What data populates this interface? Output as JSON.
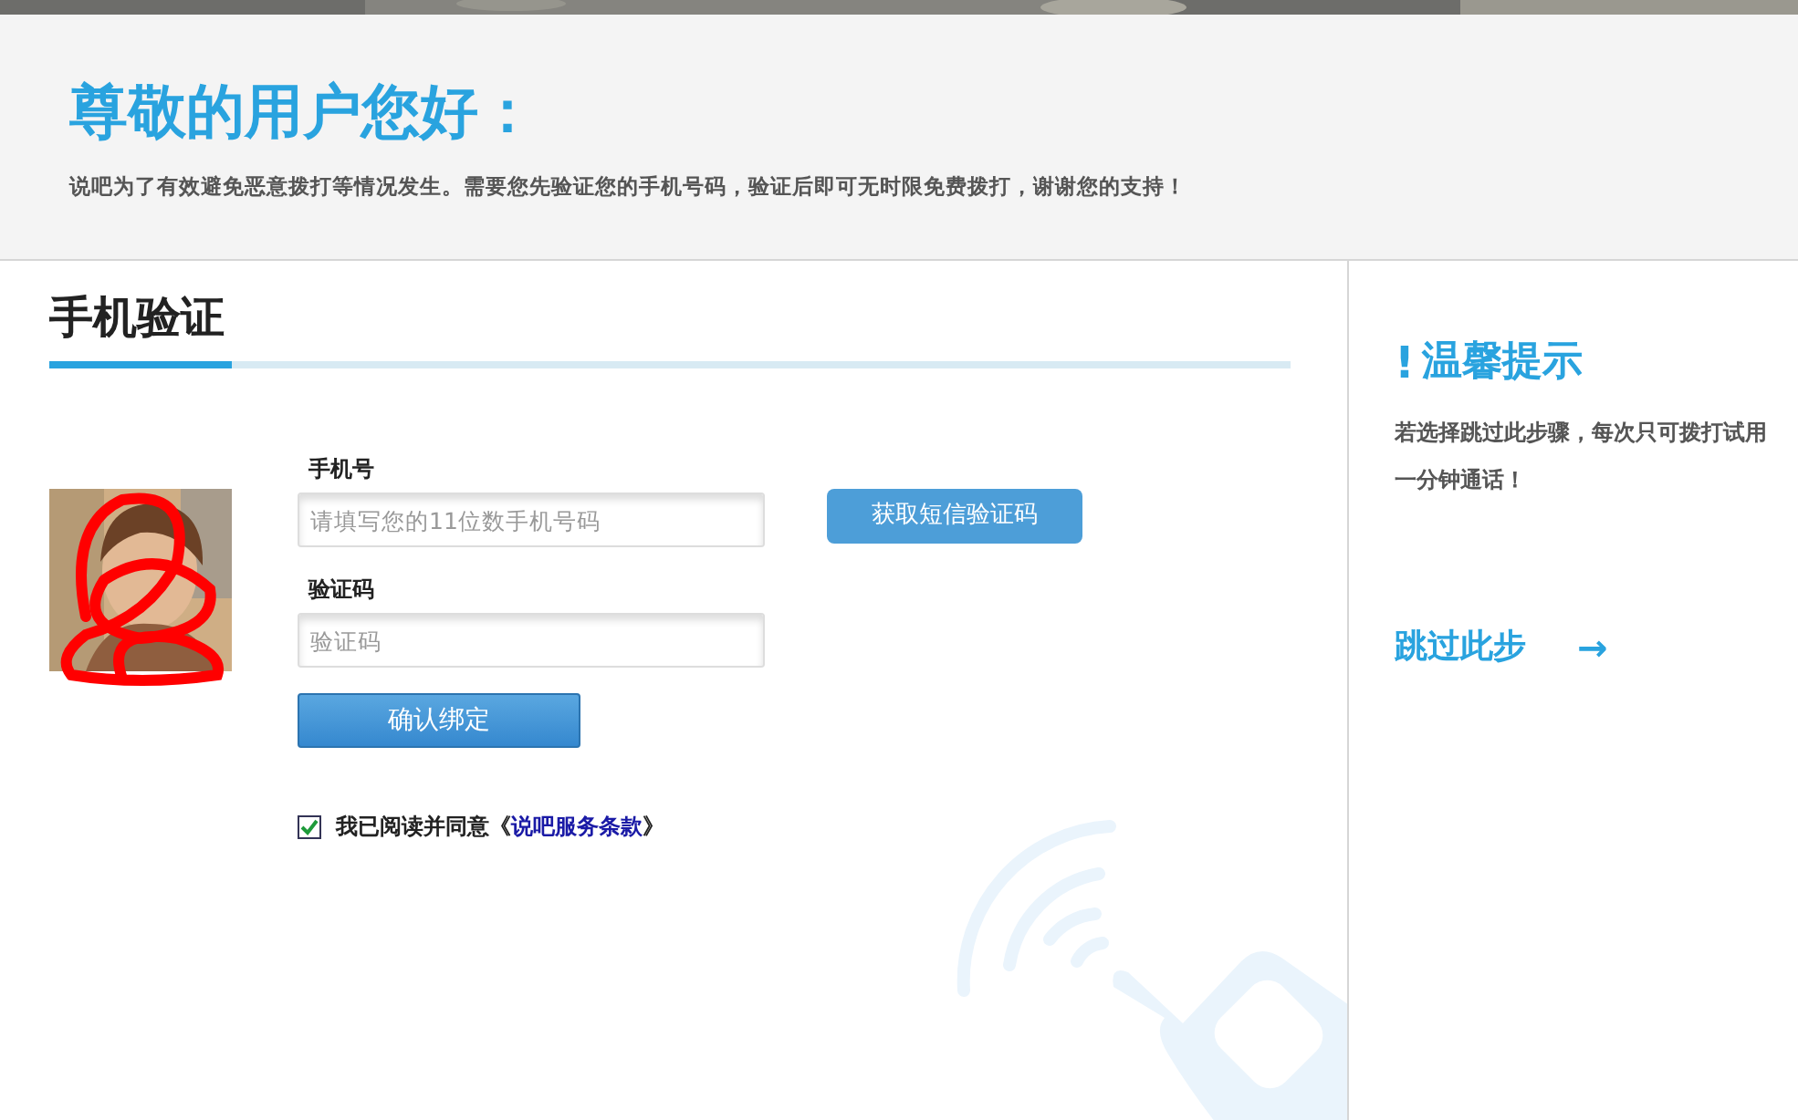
{
  "header": {
    "title": "尊敬的用户您好：",
    "message": "说吧为了有效避免恶意拨打等情况发生。需要您先验证您的手机号码，验证后即可无时限免费拨打，谢谢您的支持！"
  },
  "form": {
    "heading": "手机验证",
    "fields": [
      {
        "label": "手机号",
        "placeholder": "请填写您的11位数手机号码"
      },
      {
        "label": "验证码",
        "placeholder": "验证码"
      }
    ],
    "sms_button": "获取短信验证码",
    "submit_button": "确认绑定",
    "agreement": {
      "checked": true,
      "text": "我已阅读并同意",
      "open_quote": "《",
      "link": "说吧服务条款",
      "close_quote": "》"
    }
  },
  "tips": {
    "mark": "!",
    "title": "温馨提示",
    "text": "若选择跳过此步骤，每次只可拨打试用一分钟通话！",
    "skip_link": "跳过此步",
    "arrow": "→"
  }
}
